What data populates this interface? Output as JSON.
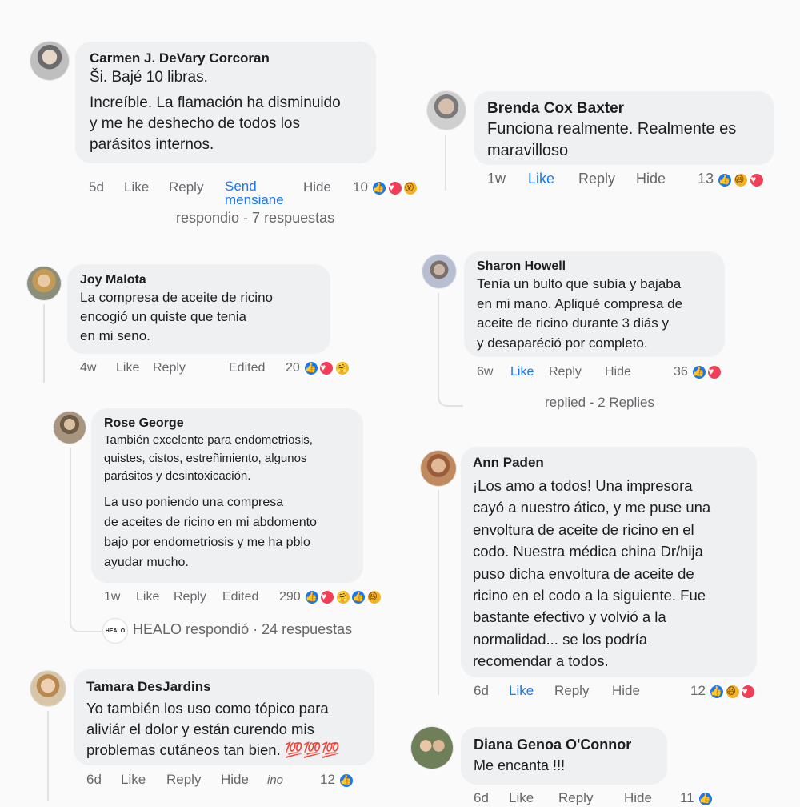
{
  "comments": [
    {
      "id": "carmen",
      "name": "Carmen J. DeVary Corcoran",
      "text": "Ši. Bajé 10 libras.",
      "text2": "Increíble. La flamación ha disminuido\ny me he deshecho de todos los\nparásitos internos.",
      "time": "5d",
      "like": "Like",
      "reply": "Reply",
      "send_line1": "Send",
      "send_line2": "mensiane",
      "hide": "Hide",
      "count": "10",
      "reactions": [
        "like-icon",
        "love-icon",
        "wow-icon"
      ],
      "replies_summary": "respondio - 7 respuestas"
    },
    {
      "id": "brenda",
      "name": "Brenda Cox Baxter",
      "text": "Funciona realmente. Realmente es\nmaravilloso",
      "time": "1w",
      "like": "Like",
      "reply": "Reply",
      "hide": "Hide",
      "count": "13",
      "reactions": [
        "like-icon",
        "haha-icon",
        "love-icon"
      ]
    },
    {
      "id": "joy",
      "name": "Joy Malota",
      "text": "La compresa de aceite de ricino\nencogió un quiste que tenia\nen mi seno.",
      "time": "4w",
      "like": "Like",
      "reply": "Reply",
      "edited": "Edited",
      "count": "20",
      "reactions": [
        "like-icon",
        "love-icon",
        "care-icon"
      ]
    },
    {
      "id": "sharon",
      "name": "Sharon Howell",
      "text": "Tenía un bulto que subía y bajaba\nen mi mano. Apliqué compresa de\naceite de ricino durante 3 diás y\ny desaparéció por completo.",
      "time": "6w",
      "like": "Like",
      "reply": "Reply",
      "hide": "Hide",
      "count": "36",
      "reactions": [
        "like-icon",
        "love-icon"
      ],
      "replies_summary": "replied - 2 Replies"
    },
    {
      "id": "rose",
      "name": "Rose George",
      "text": "También excelente para endometriosis,\nquistes, cistos, estreñimiento, algunos\nparásitos y desintoxicación.",
      "text2": "La uso poniendo una compresa\nde aceites de ricino en mi abdomento\nbajo por endometriosis y me ha pblo\nayudar mucho.",
      "time": "1w",
      "like": "Like",
      "reply": "Reply",
      "edited": "Edited",
      "count": "290",
      "reactions": [
        "like-icon",
        "love-icon",
        "care-icon",
        "like-icon",
        "haha-icon"
      ],
      "healo_logo": "HEALO",
      "replies_summary": "HEALO respondió · 24 respuestas"
    },
    {
      "id": "ann",
      "name": "Ann Paden",
      "text": "¡Los amo a todos! Una impresora\ncayó a nuestro ático, y me puse una\nenvoltura de aceite de ricino en el\ncodo. Nuestra médica china Dr/hija\npuso dicha envoltura de aceite de\nricino en el codo a la siguiente. Fue\nbastante efectivo y volvió a la\nnormalidad... se los podría\nrecomendar a todos.",
      "time": "6d",
      "like": "Like",
      "reply": "Reply",
      "hide": "Hide",
      "count": "12",
      "reactions": [
        "like-icon",
        "haha-icon",
        "love-icon"
      ]
    },
    {
      "id": "tamara",
      "name": "Tamara DesJardins",
      "text": "Yo también los uso como tópico para\naliviár el dolor y están curendo mis\nproblemas cutáneos tan bien. 💯💯💯",
      "time": "6d",
      "like": "Like",
      "reply": "Reply",
      "hide": "Hide",
      "extra": "ino",
      "count": "12",
      "reactions": [
        "like-icon"
      ]
    },
    {
      "id": "diana",
      "name": "Diana Genoa O'Connor",
      "text": "Me encanta !!!",
      "time": "6d",
      "like": "Like",
      "reply": "Reply",
      "hide": "Hide",
      "count": "11",
      "reactions": [
        "like-icon"
      ]
    }
  ],
  "colors": {
    "bubble": "#eff0f2",
    "link": "#1877f2",
    "meta": "#65676b"
  }
}
